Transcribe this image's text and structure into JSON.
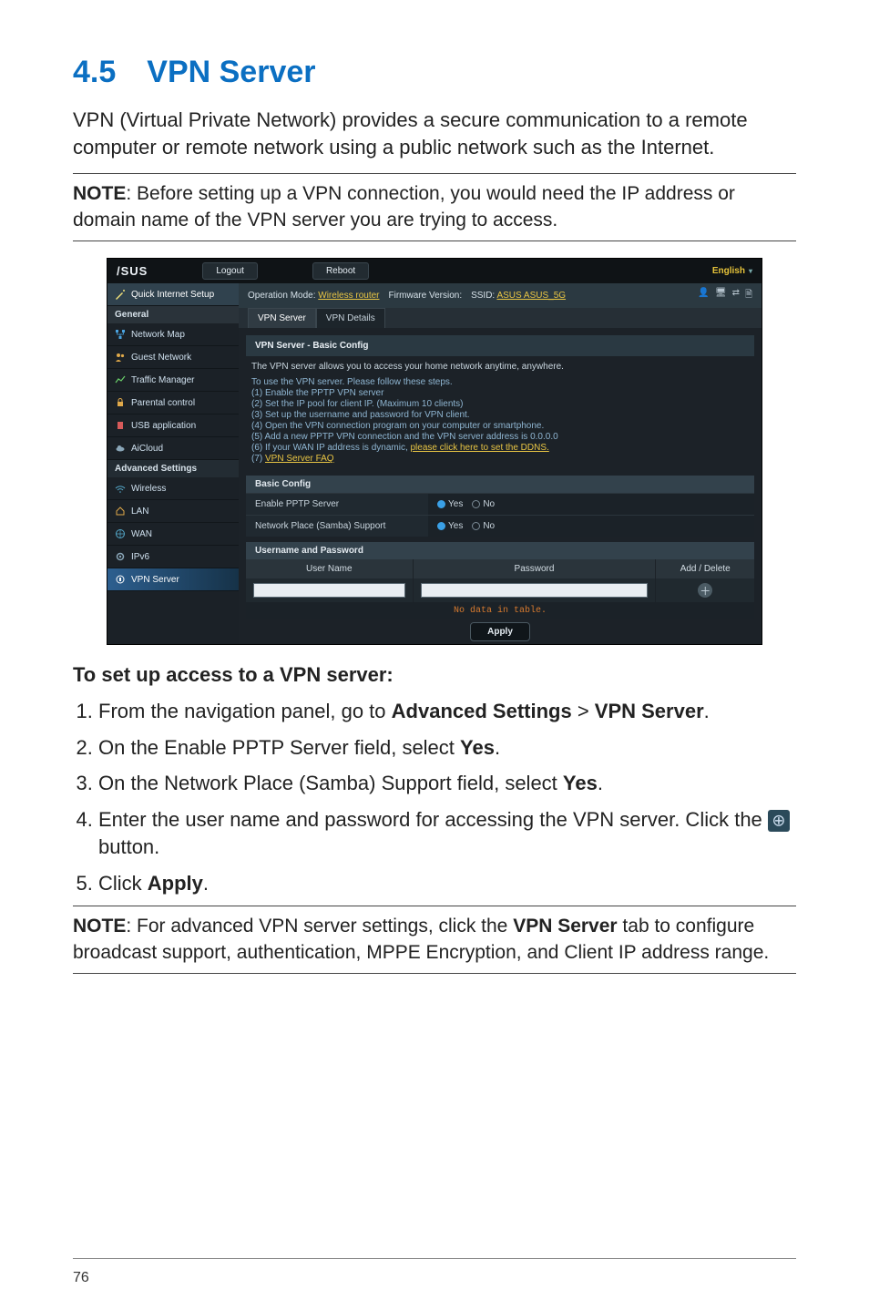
{
  "section": {
    "number": "4.5",
    "title": "VPN Server",
    "full": "4.5 VPN Server"
  },
  "intro": "VPN (Virtual Private Network) provides a secure communication to a remote computer or remote network using a public network such as the Internet.",
  "note1": {
    "label": "NOTE",
    "text": ":  Before setting up a VPN connection, you would need the IP address or domain name of the VPN server you are trying to access."
  },
  "subheading": "To set up access to a VPN server:",
  "steps": {
    "s1a": "From the navigation panel, go to ",
    "s1b": "Advanced Settings",
    "s1c": " > ",
    "s1d": "VPN Server",
    "s1e": ".",
    "s2a": "On the Enable PPTP Server field, select ",
    "s2b": "Yes",
    "s2c": ".",
    "s3a": "On the Network Place (Samba) Support field, select ",
    "s3b": "Yes",
    "s3c": ".",
    "s4a": "Enter the user name and password for accessing the VPN server. Click the ",
    "s4b": " button.",
    "s5a": "Click ",
    "s5b": "Apply",
    "s5c": "."
  },
  "note2": {
    "label": "NOTE",
    "text_a": ":  For advanced VPN server settings, click the ",
    "text_b": "VPN Server",
    "text_c": " tab to configure broadcast support, authentication, MPPE Encryption, and Client IP address range."
  },
  "page_number": "76",
  "router": {
    "logo": "/SUS",
    "logout": "Logout",
    "reboot": "Reboot",
    "language": "English",
    "info": {
      "op_mode_label": "Operation Mode: ",
      "op_mode_value": "Wireless router",
      "fw_label": "Firmware Version:",
      "ssid_label": "SSID: ",
      "ssid_value": "ASUS  ASUS_5G"
    },
    "side": {
      "quick": "Quick Internet Setup",
      "general": "General",
      "items_general": {
        "nm": "Network Map",
        "gn": "Guest Network",
        "tm": "Traffic Manager",
        "pc": "Parental control",
        "usb": "USB application",
        "ai": "AiCloud"
      },
      "adv": "Advanced Settings",
      "items_adv": {
        "wl": "Wireless",
        "lan": "LAN",
        "wan": "WAN",
        "ipv6": "IPv6",
        "vpn": "VPN Server"
      }
    },
    "tabs": {
      "t1": "VPN Server",
      "t2": "VPN Details"
    },
    "panel": {
      "title": "VPN Server - Basic Config",
      "lead": "The VPN server allows you to access your home network anytime, anywhere.",
      "intro2": "To use the VPN server. Please follow these steps.",
      "p1": "(1) Enable the PPTP VPN server",
      "p2": "(2) Set the IP pool for client IP. (Maximum 10 clients)",
      "p3": "(3) Set up the username and password for VPN client.",
      "p4": "(4) Open the VPN connection program on your computer or smartphone.",
      "p5": "(5) Add a new PPTP VPN connection and the VPN server address is 0.0.0.0",
      "p6a": "(6) If your WAN IP address is dynamic, ",
      "p6b": "please click here to set the DDNS.",
      "p7a": "(7) ",
      "p7b": "VPN Server FAQ"
    },
    "basic": {
      "title": "Basic Config",
      "row1": "Enable PPTP Server",
      "row2": "Network Place (Samba) Support",
      "yes": "Yes",
      "no": "No"
    },
    "userpass": {
      "title": "Username and Password",
      "col_user": "User Name",
      "col_pass": "Password",
      "col_add": "Add / Delete",
      "nodata": "No data in table."
    },
    "apply": "Apply"
  }
}
